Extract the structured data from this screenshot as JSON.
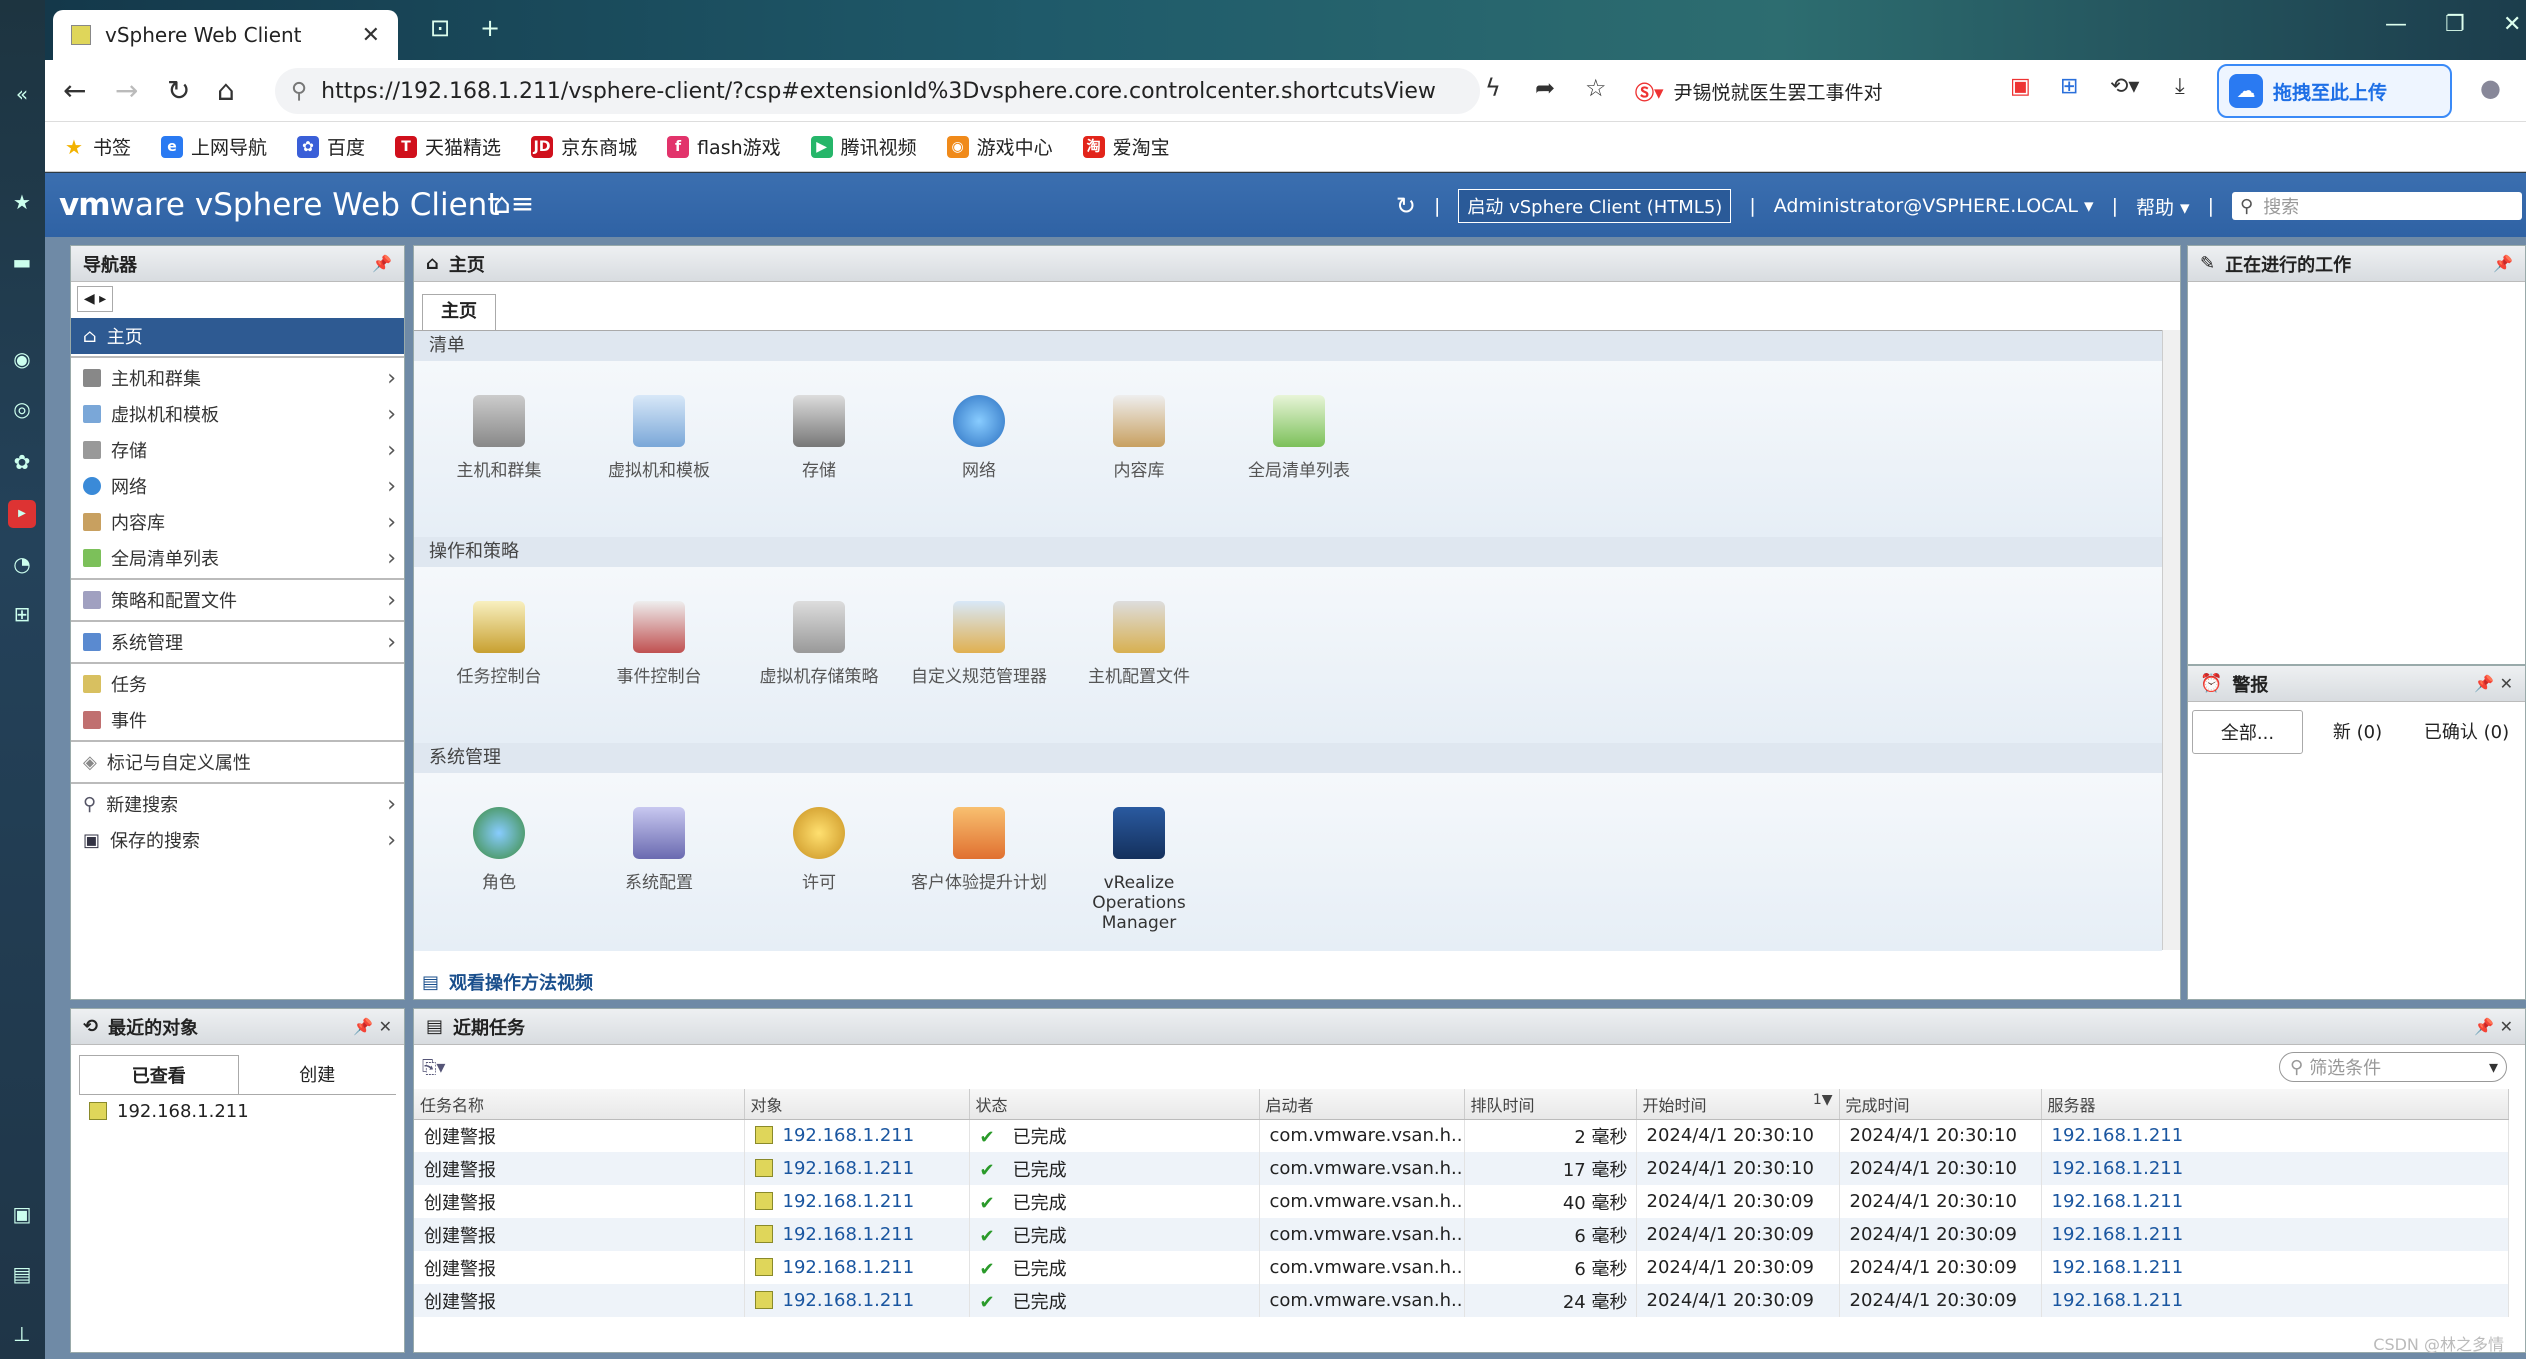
{
  "browser": {
    "tab_title": "vSphere Web Client",
    "url": "https://192.168.1.211/vsphere-client/?csp#extensionId%3Dvsphere.core.controlcenter.shortcutsView",
    "news_ext": "尹锡悦就医生罢工事件对",
    "upload_label": "拖拽至此上传",
    "bookmarks": [
      "书签",
      "上网导航",
      "百度",
      "天猫精选",
      "京东商城",
      "flash游戏",
      "腾讯视频",
      "游戏中心",
      "爱淘宝"
    ]
  },
  "header": {
    "logo_brand": "vm",
    "logo_ware": "ware",
    "product": "vSphere Web Client",
    "html5_button": "启动 vSphere Client (HTML5)",
    "user": "Administrator@VSPHERE.LOCAL",
    "help": "帮助",
    "search_placeholder": "搜索"
  },
  "navigator": {
    "title": "导航器",
    "items": [
      "主页",
      "主机和群集",
      "虚拟机和模板",
      "存储",
      "网络",
      "内容库",
      "全局清单列表",
      "策略和配置文件",
      "系统管理",
      "任务",
      "事件",
      "标记与自定义属性",
      "新建搜索",
      "保存的搜索"
    ]
  },
  "main": {
    "title": "主页",
    "tab": "主页",
    "sections": [
      {
        "title": "清单",
        "tiles": [
          "主机和群集",
          "虚拟机和模板",
          "存储",
          "网络",
          "内容库",
          "全局清单列表"
        ]
      },
      {
        "title": "操作和策略",
        "tiles": [
          "任务控制台",
          "事件控制台",
          "虚拟机存储策略",
          "自定义规范管理器",
          "主机配置文件"
        ]
      },
      {
        "title": "系统管理",
        "tiles": [
          "角色",
          "系统配置",
          "许可",
          "客户体验提升计划",
          "vRealize Operations Manager"
        ]
      }
    ],
    "howto": "观看操作方法视频"
  },
  "work": {
    "title": "正在进行的工作"
  },
  "alarms": {
    "title": "警报",
    "tabs": [
      "全部...",
      "新 (0)",
      "已确认 (0)"
    ]
  },
  "recent": {
    "title": "最近的对象",
    "tabs": [
      "已查看",
      "创建"
    ],
    "item": "192.168.1.211"
  },
  "tasks": {
    "title": "近期任务",
    "filter_placeholder": "筛选条件",
    "columns": [
      "任务名称",
      "对象",
      "状态",
      "启动者",
      "排队时间",
      "开始时间",
      "完成时间",
      "服务器"
    ],
    "sort_indicator": "1▼",
    "rows": [
      {
        "name": "创建警报",
        "object": "192.168.1.211",
        "status": "已完成",
        "initiator": "com.vmware.vsan.h...",
        "queued": "2 毫秒",
        "start": "2024/4/1 20:30:10",
        "end": "2024/4/1 20:30:10",
        "server": "192.168.1.211"
      },
      {
        "name": "创建警报",
        "object": "192.168.1.211",
        "status": "已完成",
        "initiator": "com.vmware.vsan.h...",
        "queued": "17 毫秒",
        "start": "2024/4/1 20:30:10",
        "end": "2024/4/1 20:30:10",
        "server": "192.168.1.211"
      },
      {
        "name": "创建警报",
        "object": "192.168.1.211",
        "status": "已完成",
        "initiator": "com.vmware.vsan.h...",
        "queued": "40 毫秒",
        "start": "2024/4/1 20:30:09",
        "end": "2024/4/1 20:30:10",
        "server": "192.168.1.211"
      },
      {
        "name": "创建警报",
        "object": "192.168.1.211",
        "status": "已完成",
        "initiator": "com.vmware.vsan.h...",
        "queued": "6 毫秒",
        "start": "2024/4/1 20:30:09",
        "end": "2024/4/1 20:30:09",
        "server": "192.168.1.211"
      },
      {
        "name": "创建警报",
        "object": "192.168.1.211",
        "status": "已完成",
        "initiator": "com.vmware.vsan.h...",
        "queued": "6 毫秒",
        "start": "2024/4/1 20:30:09",
        "end": "2024/4/1 20:30:09",
        "server": "192.168.1.211"
      },
      {
        "name": "创建警报",
        "object": "192.168.1.211",
        "status": "已完成",
        "initiator": "com.vmware.vsan.h...",
        "queued": "24 毫秒",
        "start": "2024/4/1 20:30:09",
        "end": "2024/4/1 20:30:09",
        "server": "192.168.1.211"
      }
    ]
  },
  "watermark": "CSDN @林之多情",
  "colors": {
    "header_blue": "#2f62a4",
    "selected_nav": "#2e5a92",
    "link": "#1a56a0"
  }
}
